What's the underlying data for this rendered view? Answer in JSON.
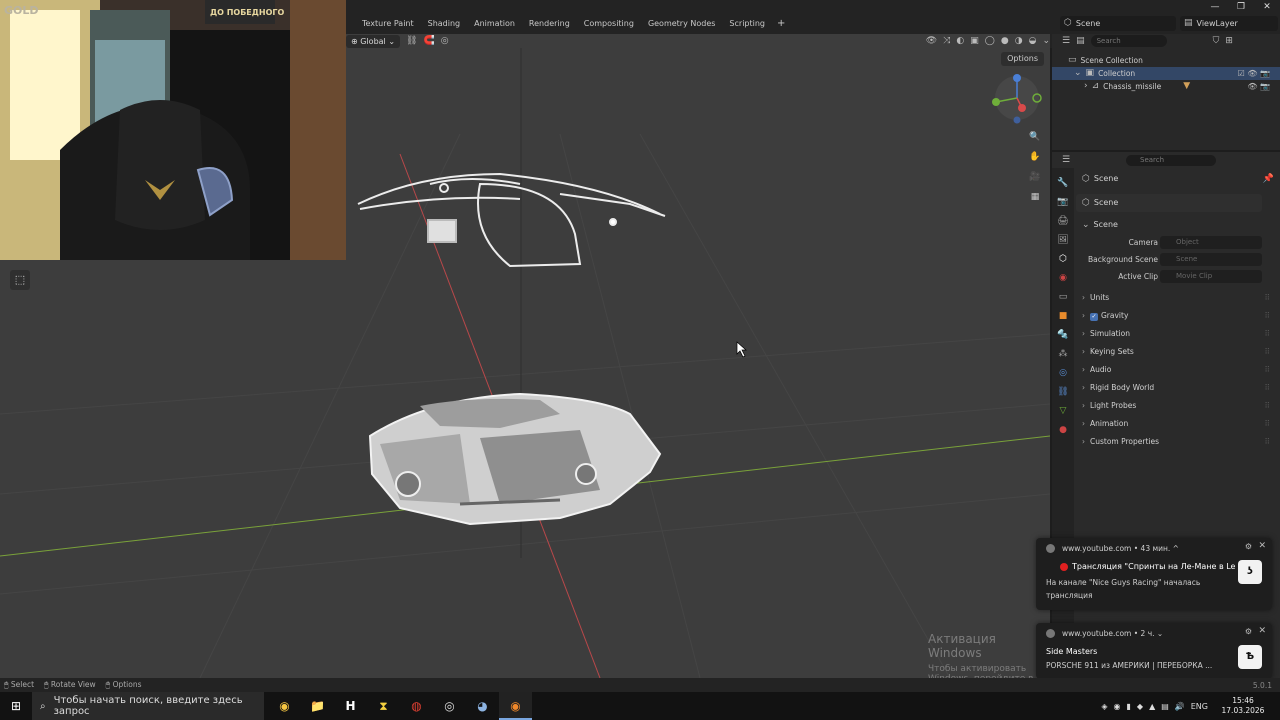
{
  "window": {
    "controls": [
      "—",
      "❐",
      "✕"
    ]
  },
  "workspace_tabs": [
    "Texture Paint",
    "Shading",
    "Animation",
    "Rendering",
    "Compositing",
    "Geometry Nodes",
    "Scripting"
  ],
  "workspace_add": "+",
  "scene_selector": {
    "label": "Scene"
  },
  "view_layer_selector": {
    "label": "ViewLayer"
  },
  "viewport": {
    "transform_orientation": "Global",
    "options_label": "Options",
    "watermark_line1": "Активация Windows",
    "watermark_line2": "Чтобы активировать Windows, перейдите в раздел \"Параметры\"."
  },
  "webcam": {
    "sign_text": "ДО ПОБЕДНОГО",
    "gold_text": "GOLD"
  },
  "outliner": {
    "search_placeholder": "Search",
    "scene_collection": "Scene Collection",
    "collection": "Collection",
    "object": "Chassis_missile"
  },
  "properties": {
    "search_placeholder": "Search",
    "context": "Scene",
    "datablock": "Scene",
    "panel_title": "Scene",
    "camera_label": "Camera",
    "camera_placeholder": "Object",
    "background_label": "Background Scene",
    "background_placeholder": "Scene",
    "clip_label": "Active Clip",
    "clip_placeholder": "Movie Clip",
    "sections": [
      "Units",
      "Gravity",
      "Simulation",
      "Keying Sets",
      "Audio",
      "Rigid Body World",
      "Light Probes",
      "Animation",
      "Custom Properties"
    ],
    "gravity_checked": true
  },
  "notifications": [
    {
      "source": "www.youtube.com • 43 мин. ^",
      "title": "Трансляция \"Спринты на Ле-Мане в Le ...",
      "body": "На канале \"Nice Guys Racing\" началась трансляция"
    },
    {
      "source": "www.youtube.com • 2 ч. ⌄",
      "title": "Side Masters",
      "body": "PORSCHE 911 из АМЕРИКИ | ПЕРЕБОРКА ..."
    }
  ],
  "status_bar": {
    "select": "Select",
    "rotate": "Rotate View",
    "options": "Options",
    "version": "5.0.1"
  },
  "taskbar": {
    "search_placeholder": "Чтобы начать поиск, введите здесь запрос",
    "lang": "ENG",
    "time": "15:46",
    "date": "17.03.2026"
  },
  "colors": {
    "accent": "#4772b3",
    "viewport_bg": "#3d3d3d",
    "x_axis": "#c24b4b",
    "y_axis": "#7ab33e"
  }
}
